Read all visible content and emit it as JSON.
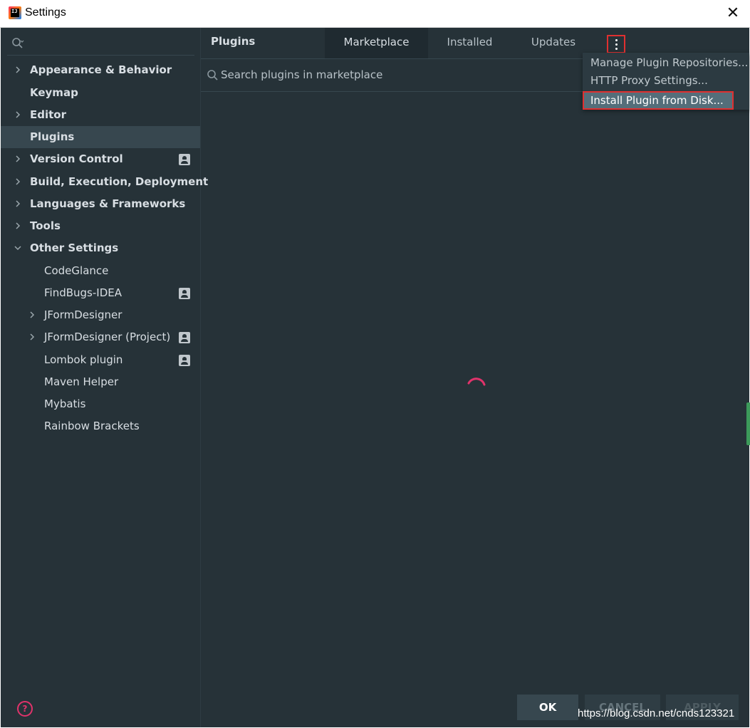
{
  "window": {
    "title": "Settings",
    "logo_text": "IJ",
    "close_glyph": "✕"
  },
  "sidebar": {
    "search_icon": "search-icon",
    "items": [
      {
        "label": "Appearance & Behavior",
        "bold": true,
        "chevron": "right"
      },
      {
        "label": "Keymap",
        "bold": true
      },
      {
        "label": "Editor",
        "bold": true,
        "chevron": "right"
      },
      {
        "label": "Plugins",
        "bold": true,
        "selected": true
      },
      {
        "label": "Version Control",
        "bold": true,
        "chevron": "right",
        "badge": "project-icon"
      },
      {
        "label": "Build, Execution, Deployment",
        "bold": true,
        "chevron": "right"
      },
      {
        "label": "Languages & Frameworks",
        "bold": true,
        "chevron": "right"
      },
      {
        "label": "Tools",
        "bold": true,
        "chevron": "right"
      },
      {
        "label": "Other Settings",
        "bold": true,
        "chevron": "down"
      },
      {
        "label": "CodeGlance"
      },
      {
        "label": "FindBugs-IDEA",
        "badge": "project-icon"
      },
      {
        "label": "JFormDesigner",
        "chevron": "right"
      },
      {
        "label": "JFormDesigner (Project)",
        "chevron": "right",
        "badge": "project-icon"
      },
      {
        "label": "Lombok plugin",
        "badge": "project-icon"
      },
      {
        "label": "Maven Helper"
      },
      {
        "label": "Mybatis"
      },
      {
        "label": "Rainbow Brackets"
      }
    ]
  },
  "header": {
    "title": "Plugins",
    "tabs": [
      {
        "label": "Marketplace",
        "active": true
      },
      {
        "label": "Installed"
      },
      {
        "label": "Updates"
      }
    ],
    "more_icon": "more-vertical-icon"
  },
  "search": {
    "placeholder": "Search plugins in marketplace"
  },
  "menu": {
    "items": [
      {
        "label": "Manage Plugin Repositories..."
      },
      {
        "label": "HTTP Proxy Settings..."
      },
      {
        "label": "Install Plugin from Disk...",
        "highlighted": true
      }
    ]
  },
  "footer": {
    "help_glyph": "?",
    "ok": "OK",
    "cancel": "CANCEL",
    "apply": "APPLY",
    "watermark": "https://blog.csdn.net/cnds123321"
  },
  "colors": {
    "accent": "#e03030",
    "spinner": "#e0336b",
    "background": "#263238"
  }
}
